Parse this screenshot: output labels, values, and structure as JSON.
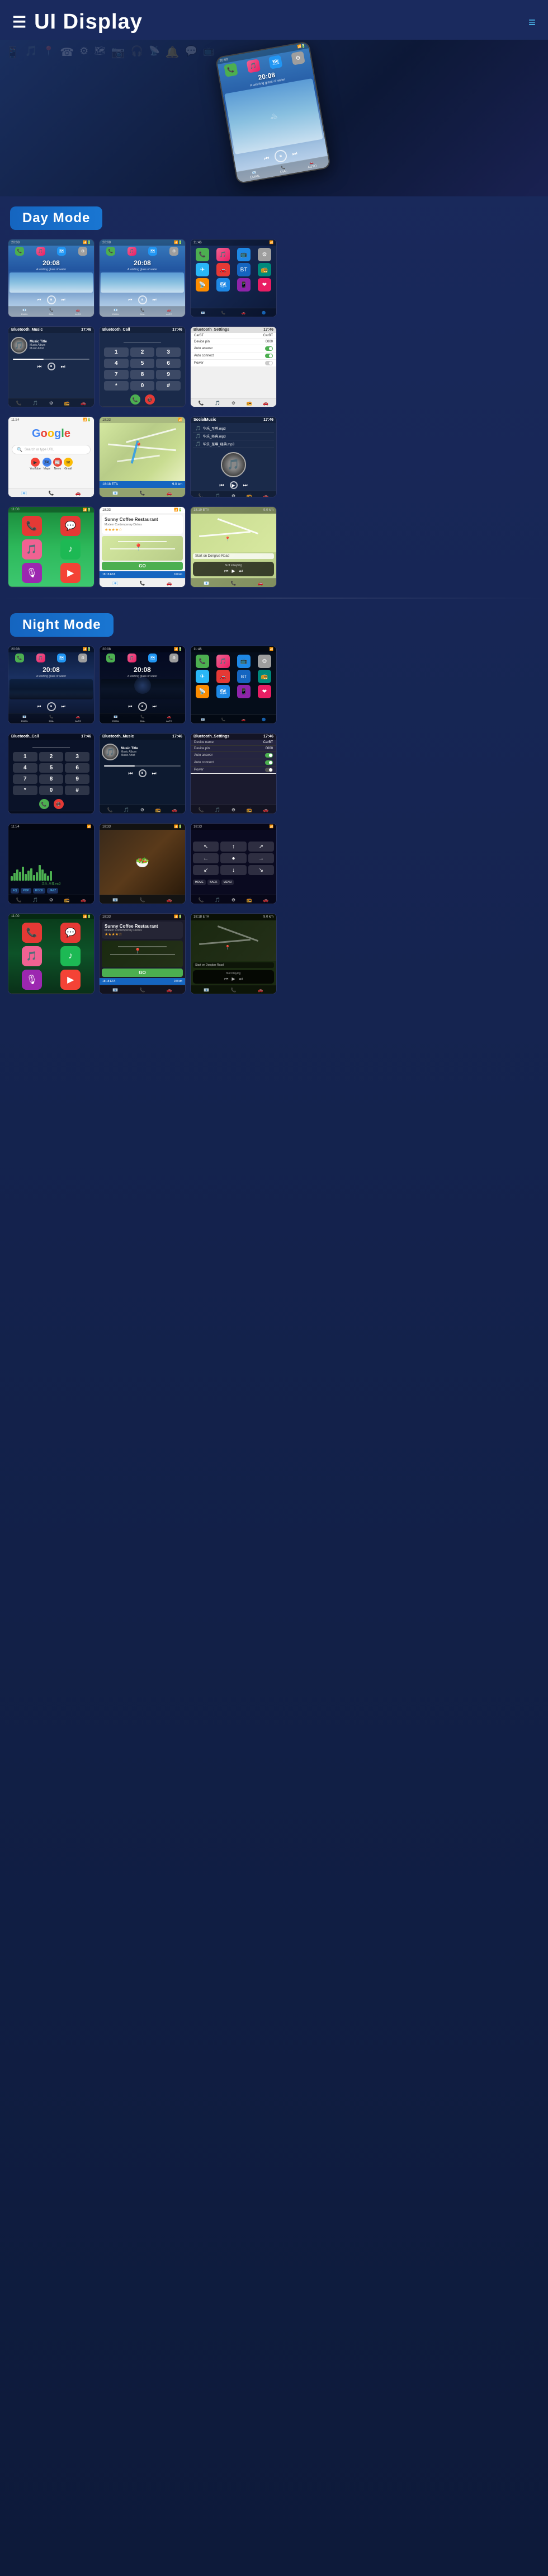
{
  "header": {
    "title": "UI Display",
    "menu_icon": "☰",
    "hamburger_icon": "≡"
  },
  "sections": {
    "day_mode": "Day Mode",
    "night_mode": "Night Mode"
  },
  "screens": {
    "hero_time": "20:08",
    "day_music_time": "20:08",
    "day_music_subtitle": "A wishing glass of water",
    "music_title": "Music Title",
    "music_album": "Music Album",
    "music_artist": "Music Artist",
    "bluetooth_music": "Bluetooth_Music",
    "bluetooth_call": "Bluetooth_Call",
    "bluetooth_settings": "Bluetooth_Settings",
    "device_name": "CarBT",
    "device_pin": "0000",
    "auto_answer": "Auto answer",
    "auto_connect": "Auto connect",
    "power": "Power",
    "social_music": "SocialMusic",
    "google_search": "Google",
    "sunny_coffee": "Sunny Coffee Restaurant",
    "sunny_address": "Modern Contemporary Dishes",
    "eta_time": "18:18 ETA",
    "eta_distance": "9.0 km",
    "go_label": "GO",
    "not_playing": "Not Playing",
    "donglue_road": "Start on Donglue Road",
    "night_music_time": "20:08",
    "waveform_label": "华乐_至尊.mp3",
    "file1": "华乐_至尊.mp3",
    "file2": "华乐_经典.mp3",
    "file3": "华乐_至尊_经典.mp3"
  },
  "colors": {
    "accent_blue": "#1565c0",
    "accent_light": "#4fc3f7",
    "day_bg_start": "#3a7fc1",
    "night_bg_start": "#0a1228",
    "section_label_bg": "#1565c0"
  }
}
